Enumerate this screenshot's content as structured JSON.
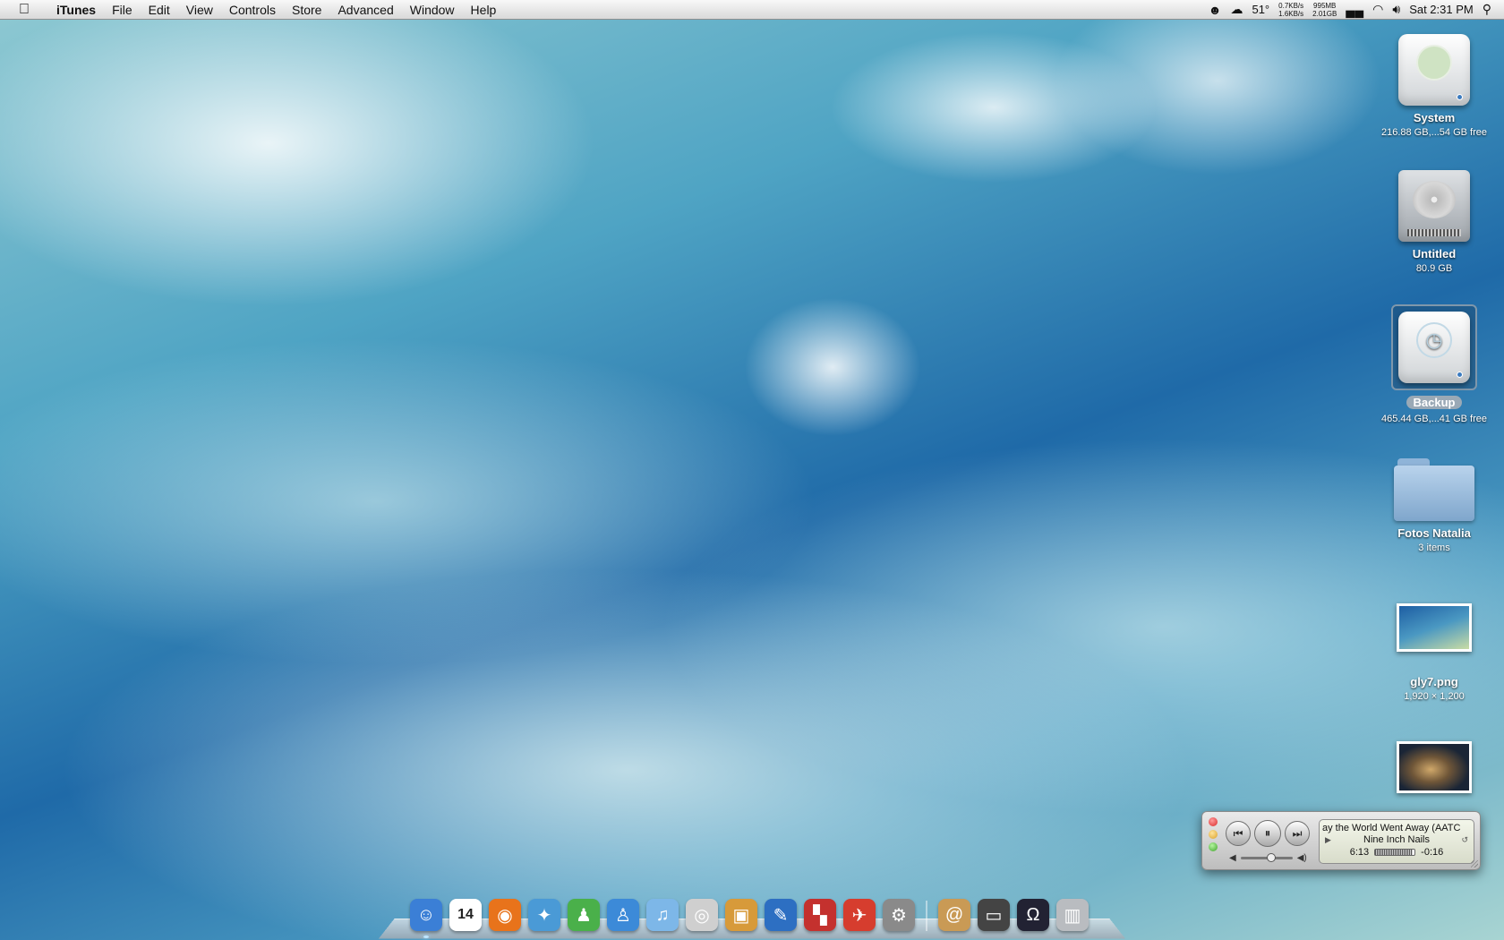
{
  "menubar": {
    "app_name": "iTunes",
    "menus": [
      "File",
      "Edit",
      "View",
      "Controls",
      "Store",
      "Advanced",
      "Window",
      "Help"
    ],
    "status": {
      "temperature": "51°",
      "net_up": "0.7KB/s",
      "net_down": "1.6KB/s",
      "mem_used": "995MB",
      "mem_free": "2.01GB",
      "clock": "Sat 2:31 PM"
    }
  },
  "desktop_icons": [
    {
      "name": "System",
      "info": "216.88 GB,...54 GB free",
      "kind": "drive"
    },
    {
      "name": "Untitled",
      "info": "80.9 GB",
      "kind": "hard-disk"
    },
    {
      "name": "Backup",
      "info": "465.44 GB,...41 GB free",
      "kind": "time-machine-drive",
      "selected": true
    },
    {
      "name": "Fotos Natalia",
      "info": "3 items",
      "kind": "folder"
    },
    {
      "name": "gly7.png",
      "info": "1,920 × 1,200",
      "kind": "image-file"
    },
    {
      "name": "",
      "info": "",
      "kind": "image-file"
    }
  ],
  "dock": {
    "apps": [
      {
        "icon": "finder-icon",
        "color": "#3b7fd6"
      },
      {
        "icon": "ical-icon",
        "color": "#ffffff",
        "label": "14"
      },
      {
        "icon": "firefox-icon",
        "color": "#e8731b"
      },
      {
        "icon": "safari-icon",
        "color": "#4a9ad6"
      },
      {
        "icon": "adium-icon",
        "color": "#4ab04a"
      },
      {
        "icon": "messenger-icon",
        "color": "#3c8ad8"
      },
      {
        "icon": "itunes-icon",
        "color": "#7db7e8"
      },
      {
        "icon": "dvd-player-icon",
        "color": "#cfcfcf"
      },
      {
        "icon": "iphoto-icon",
        "color": "#d79a3a"
      },
      {
        "icon": "cyberduck-icon",
        "color": "#2d6fc2"
      },
      {
        "icon": "parallels-icon",
        "color": "#c4312e"
      },
      {
        "icon": "transmit-icon",
        "color": "#d63d2e"
      },
      {
        "icon": "system-preferences-icon",
        "color": "#8a8a8a"
      }
    ],
    "docs": [
      {
        "icon": "address-book-icon",
        "color": "#c99a55"
      },
      {
        "icon": "downloads-stack-icon",
        "color": "#444444"
      },
      {
        "icon": "front-row-icon",
        "color": "#222233"
      },
      {
        "icon": "trash-icon",
        "color": "#b9bcc0"
      }
    ]
  },
  "mini_player": {
    "song_title": "ay the World Went Away (AATC",
    "artist": "Nine Inch Nails",
    "elapsed": "6:13",
    "remaining": "-0:16",
    "progress_fraction": 0.96,
    "volume_fraction": 0.6,
    "buttons": {
      "previous": "⏮",
      "play_pause": "⏸",
      "next": "⏭"
    }
  }
}
